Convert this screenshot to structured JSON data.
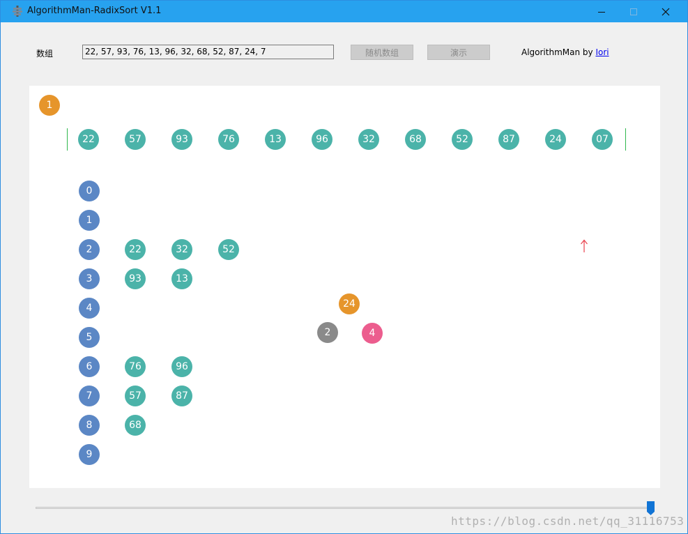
{
  "window": {
    "title": "AlgorithmMan-RadixSort V1.1"
  },
  "form": {
    "array_label": "数组",
    "array_value": "22, 57, 93, 76, 13, 96, 32, 68, 52, 87, 24, 7",
    "random_button": "随机数组",
    "demo_button": "演示",
    "credit_prefix": "AlgorithmMan by ",
    "credit_link": "Iori"
  },
  "viz": {
    "step_marker": "1",
    "sequence": [
      "22",
      "57",
      "93",
      "76",
      "13",
      "96",
      "32",
      "68",
      "52",
      "87",
      "24",
      "07"
    ],
    "current_index": 10,
    "buckets": [
      {
        "digit": "0",
        "items": []
      },
      {
        "digit": "1",
        "items": []
      },
      {
        "digit": "2",
        "items": [
          "22",
          "32",
          "52"
        ]
      },
      {
        "digit": "3",
        "items": [
          "93",
          "13"
        ]
      },
      {
        "digit": "4",
        "items": []
      },
      {
        "digit": "5",
        "items": []
      },
      {
        "digit": "6",
        "items": [
          "76",
          "96"
        ]
      },
      {
        "digit": "7",
        "items": [
          "57",
          "87"
        ]
      },
      {
        "digit": "8",
        "items": [
          "68"
        ]
      },
      {
        "digit": "9",
        "items": []
      }
    ],
    "current_value": "24",
    "digit_left": "2",
    "digit_right": "4"
  },
  "playback": {
    "progress_fraction": 1.0
  },
  "watermark": "https://blog.csdn.net/qq_31116753",
  "colors": {
    "titlebar": "#27a2ef",
    "teal": "#4bb3a9",
    "bucket_blue": "#5b87c5",
    "orange": "#e6952b",
    "gray": "#8a8a8a",
    "pink": "#ec5d8e",
    "boundary_green": "#2fb84d",
    "pointer_red": "#e8414c",
    "thumb_blue": "#1174d5"
  }
}
